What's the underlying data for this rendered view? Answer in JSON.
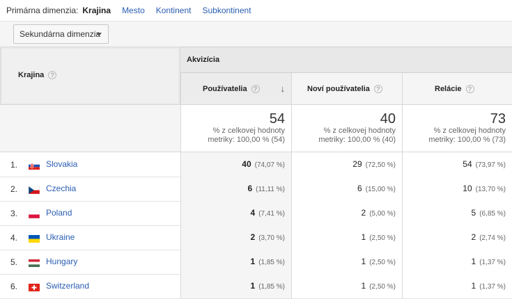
{
  "dimension_bar": {
    "label": "Primárna dimenzia:",
    "current": "Krajina",
    "options": [
      "Mesto",
      "Kontinent",
      "Subkontinent"
    ]
  },
  "secondary": {
    "label": "Sekundárna dimenzia"
  },
  "table": {
    "country_header": "Krajina",
    "group_header": "Akvizícia",
    "metrics": [
      {
        "label": "Používatelia",
        "total": "54",
        "total_sub1": "% z celkovej hodnoty",
        "total_sub2": "metriky: 100,00 % (54)"
      },
      {
        "label": "Noví používatelia",
        "total": "40",
        "total_sub1": "% z celkovej hodnoty",
        "total_sub2": "metriky: 100,00 % (40)"
      },
      {
        "label": "Relácie",
        "total": "73",
        "total_sub1": "% z celkovej hodnoty",
        "total_sub2": "metriky: 100,00 % (73)"
      }
    ],
    "rows": [
      {
        "num": "1.",
        "country": "Slovakia",
        "flag": "sk",
        "users": "40",
        "users_pct": "(74,07 %)",
        "new": "29",
        "new_pct": "(72,50 %)",
        "sessions": "54",
        "sessions_pct": "(73,97 %)"
      },
      {
        "num": "2.",
        "country": "Czechia",
        "flag": "cz",
        "users": "6",
        "users_pct": "(11,11 %)",
        "new": "6",
        "new_pct": "(15,00 %)",
        "sessions": "10",
        "sessions_pct": "(13,70 %)"
      },
      {
        "num": "3.",
        "country": "Poland",
        "flag": "pl",
        "users": "4",
        "users_pct": "(7,41 %)",
        "new": "2",
        "new_pct": "(5,00 %)",
        "sessions": "5",
        "sessions_pct": "(6,85 %)"
      },
      {
        "num": "4.",
        "country": "Ukraine",
        "flag": "ua",
        "users": "2",
        "users_pct": "(3,70 %)",
        "new": "1",
        "new_pct": "(2,50 %)",
        "sessions": "2",
        "sessions_pct": "(2,74 %)"
      },
      {
        "num": "5.",
        "country": "Hungary",
        "flag": "hu",
        "users": "1",
        "users_pct": "(1,85 %)",
        "new": "1",
        "new_pct": "(2,50 %)",
        "sessions": "1",
        "sessions_pct": "(1,37 %)"
      },
      {
        "num": "6.",
        "country": "Switzerland",
        "flag": "ch",
        "users": "1",
        "users_pct": "(1,85 %)",
        "new": "1",
        "new_pct": "(2,50 %)",
        "sessions": "1",
        "sessions_pct": "(1,37 %)"
      }
    ]
  },
  "colors": {
    "link": "#2a5db0"
  }
}
